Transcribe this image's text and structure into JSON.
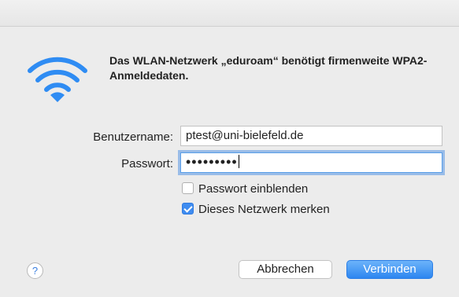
{
  "dialog": {
    "heading": "Das WLAN-Netzwerk „eduroam“ benötigt firmenweite WPA2-Anmeldedaten.",
    "icon": "wifi-icon",
    "username_label": "Benutzername:",
    "username_value": "ptest@uni-bielefeld.de",
    "password_label": "Passwort:",
    "password_value": "•••••••••",
    "show_password_label": "Passwort einblenden",
    "show_password_checked": false,
    "remember_label": "Dieses Netzwerk merken",
    "remember_checked": true,
    "help_label": "?",
    "cancel_label": "Abbrechen",
    "connect_label": "Verbinden"
  },
  "colors": {
    "accent": "#3f8cf0",
    "wifi": "#2f8cf3"
  }
}
